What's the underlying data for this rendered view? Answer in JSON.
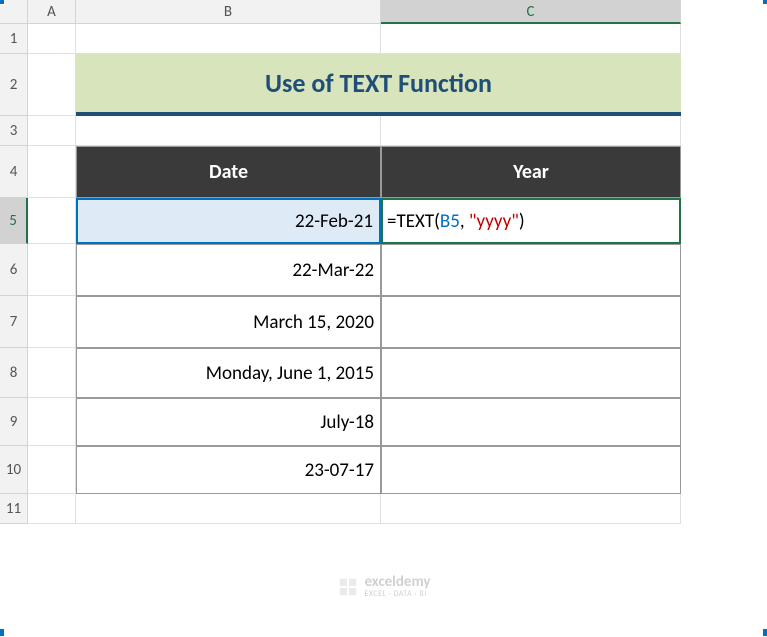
{
  "columns": {
    "corner": "",
    "A": "A",
    "B": "B",
    "C": "C"
  },
  "rows": {
    "r1": "1",
    "r2": "2",
    "r3": "3",
    "r4": "4",
    "r5": "5",
    "r6": "6",
    "r7": "7",
    "r8": "8",
    "r9": "9",
    "r10": "10",
    "r11": "11"
  },
  "title": "Use of TEXT Function",
  "headers": {
    "date": "Date",
    "year": "Year"
  },
  "data": {
    "b5": "22-Feb-21",
    "b6": "22-Mar-22",
    "b7": "March 15, 2020",
    "b8": "Monday, June 1, 2015",
    "b9": "July-18",
    "b10": "23-07-17"
  },
  "formula": {
    "prefix": "=TEXT(",
    "ref": "B5",
    "mid": ", ",
    "str": "\"yyyy\"",
    "suffix": ")"
  },
  "watermark": {
    "name": "exceldemy",
    "tagline": "EXCEL · DATA · BI"
  }
}
